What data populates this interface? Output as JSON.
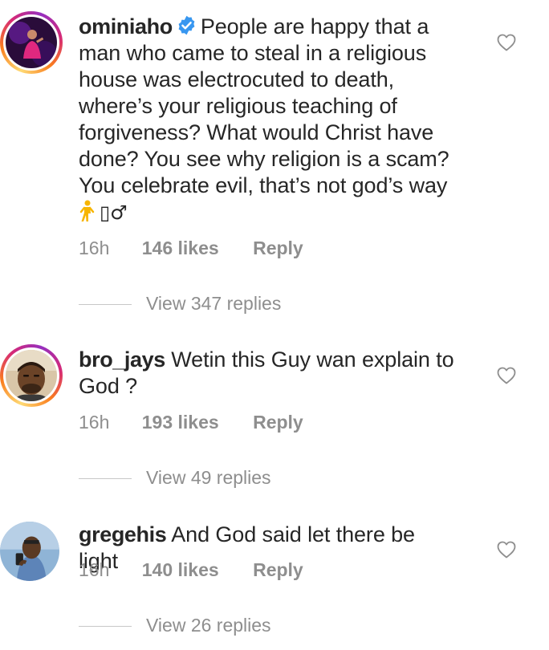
{
  "comments": [
    {
      "username": "ominiaho",
      "verified": true,
      "text_lines": [
        "People are happy that a",
        "man who came to steal in a religious",
        "house was electrocuted to death,",
        "where’s your religious teaching of",
        "forgiveness? What would Christ have",
        "done? You see why religion is a scam?",
        "You celebrate evil, that’s not god’s way"
      ],
      "emoji_text": "🚶‍♂",
      "time": "16h",
      "likes": "146 likes",
      "reply_label": "Reply",
      "view_replies": "View 347 replies",
      "has_story_ring": true
    },
    {
      "username": "bro_jays",
      "verified": false,
      "text_lines": [
        "Wetin this Guy wan explain to",
        "God ?"
      ],
      "time": "16h",
      "likes": "193 likes",
      "reply_label": "Reply",
      "view_replies": "View 49 replies",
      "has_story_ring": true
    },
    {
      "username": "gregehis",
      "verified": false,
      "text_lines": [
        "And God said let there be light"
      ],
      "time": "16h",
      "likes": "140 likes",
      "reply_label": "Reply",
      "view_replies": "View 26 replies",
      "has_story_ring": false
    }
  ],
  "icons": {
    "verified": "verified-badge-icon",
    "like": "heart-outline-icon"
  },
  "colors": {
    "verified_blue": "#3897f0",
    "secondary_text": "#8e8e8e",
    "primary_text": "#262626"
  }
}
